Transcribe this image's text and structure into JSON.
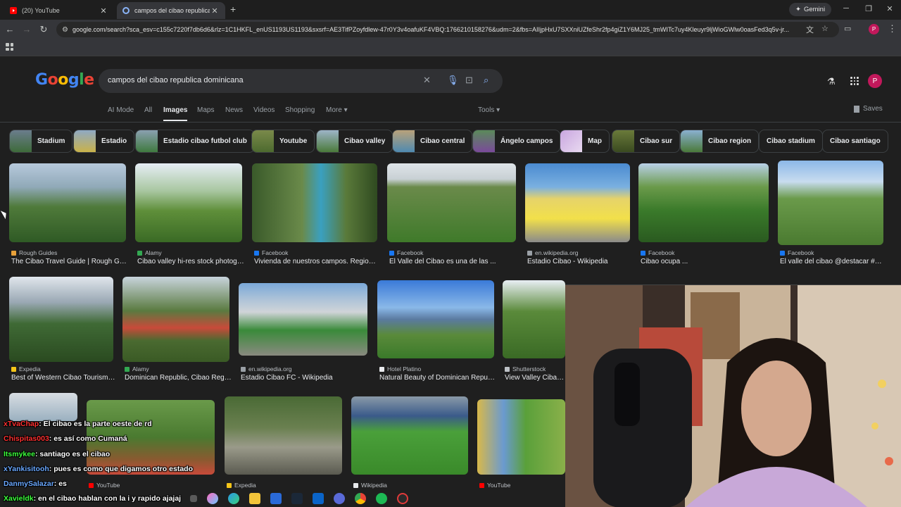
{
  "browser": {
    "tabs": [
      {
        "title": "(20) YouTube",
        "icon": "youtube-icon",
        "active": false
      },
      {
        "title": "campos del cibao republica dom",
        "icon": "google-icon",
        "active": true
      }
    ],
    "gemini_label": "Gemini",
    "url": "google.com/search?sca_esv=c155c7220f7db6d6&rlz=1C1HKFL_enUS1193US1193&sxsrf=AE3TifPZoyfdlew-47r0Y3v4oafuKF4VBQ:1766210158276&udm=2&fbs=AIIjpHxU7SXXniUZfeShr2fp4giZ1Y6MJ25_tmWITc7uy4Kleuyr9ljWioGWlw0oasFed3q5v-jr...",
    "profile_initial": "P"
  },
  "search": {
    "query": "campos del cibao republica dominicana",
    "avatar_initial": "P"
  },
  "nav": {
    "tabs": [
      "AI Mode",
      "All",
      "Images",
      "Maps",
      "News",
      "Videos",
      "Shopping",
      "More"
    ],
    "active": "Images",
    "tools": "Tools",
    "saves": "Saves"
  },
  "chips": [
    "Stadium",
    "Estadio",
    "Estadio cibao futbol club",
    "Youtube",
    "Cibao valley",
    "Cibao central",
    "Ángelo campos",
    "Map",
    "Cibao sur",
    "Cibao region",
    "Cibao stadium",
    "Cibao santiago"
  ],
  "results": [
    {
      "source": "Rough Guides",
      "caption": "The Cibao Travel Guide | Rough Gui..."
    },
    {
      "source": "Alamy",
      "caption": "Cibao valley hi-res stock photogr..."
    },
    {
      "source": "Facebook",
      "caption": "Vivienda de nuestros campos. Region ..."
    },
    {
      "source": "Facebook",
      "caption": "El Valle del Cibao es una de las ..."
    },
    {
      "source": "en.wikipedia.org",
      "caption": "Estadio Cibao - Wikipedia"
    },
    {
      "source": "Facebook",
      "caption": "Cibao ocupa ..."
    },
    {
      "source": "Facebook",
      "caption": "El valle del cibao @destacar #m..."
    },
    {
      "source": "Expedia",
      "caption": "Best of Western Cibao Tourism ..."
    },
    {
      "source": "Alamy",
      "caption": "Dominican Republic, Cibao Regi..."
    },
    {
      "source": "en.wikipedia.org",
      "caption": "Estadio Cibao FC - Wikipedia"
    },
    {
      "source": "Hotel Platino",
      "caption": "Natural Beauty of Dominican Republ..."
    },
    {
      "source": "Shutterstock",
      "caption": "View Valley Cibao Sa..."
    },
    {
      "source": "YouTube",
      "caption": ""
    },
    {
      "source": "Expedia",
      "caption": ""
    },
    {
      "source": "Wikipedia",
      "caption": ""
    },
    {
      "source": "YouTube",
      "caption": ""
    }
  ],
  "chat": [
    {
      "user": "xTvaChap",
      "user_color": "#ff3030",
      "message": ": El cibao es la parte oeste de rd"
    },
    {
      "user": "Chispitas003",
      "user_color": "#ff3030",
      "message": ": es así como Cumaná"
    },
    {
      "user": "Itsmykee",
      "user_color": "#3cff3c",
      "message": ": santiago es el cibao"
    },
    {
      "user": "xYankisitooh",
      "user_color": "#6aa8ff",
      "message": ": pues es como que digamos otro estado"
    },
    {
      "user": "DanmySalazar",
      "user_color": "#6aa8ff",
      "message": ": es"
    },
    {
      "user": "Xavieldk",
      "user_color": "#3cff3c",
      "message": ": en el cibao hablan con la i y rapido ajajaj"
    }
  ]
}
